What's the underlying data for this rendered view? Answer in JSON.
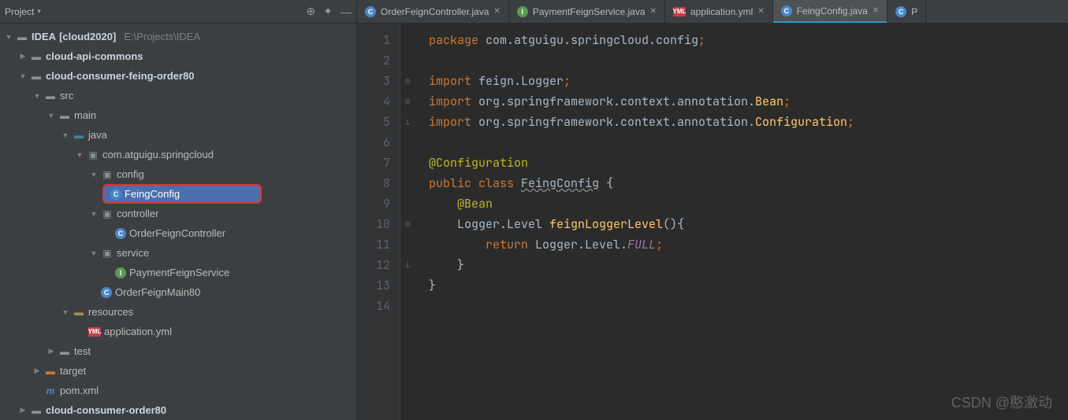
{
  "sidebar": {
    "title": "Project",
    "root": {
      "name": "IDEA",
      "project": "[cloud2020]",
      "path": "E:\\Projects\\IDEA"
    },
    "modules": {
      "api_commons": "cloud-api-commons",
      "feign_order": "cloud-consumer-feing-order80",
      "test": "test",
      "target": "target",
      "pom": "pom.xml",
      "last": "cloud-consumer-order80"
    },
    "src": {
      "label": "src",
      "main": "main",
      "java": "java",
      "pkg": "com.atguigu.springcloud",
      "config": "config",
      "feing": "FeingConfig",
      "controller": "controller",
      "orderctrl": "OrderFeignController",
      "service": "service",
      "paysvc": "PaymentFeignService",
      "mainclass": "OrderFeignMain80",
      "resources": "resources",
      "appyml": "application.yml"
    }
  },
  "tabs": [
    {
      "label": "OrderFeignController.java",
      "type": "java"
    },
    {
      "label": "PaymentFeignService.java",
      "type": "interface"
    },
    {
      "label": "application.yml",
      "type": "yml"
    },
    {
      "label": "FeingConfig.java",
      "type": "java",
      "active": true
    },
    {
      "label": "P",
      "type": "java",
      "partial": true
    }
  ],
  "code": {
    "lines": [
      1,
      2,
      3,
      4,
      5,
      6,
      7,
      8,
      9,
      10,
      11,
      12,
      13,
      14
    ],
    "l1_kw": "package",
    "l1_pkg": " com.atguigu.springcloud.config",
    "semi": ";",
    "l3_kw": "import",
    "l3_pkg": " feign.Logger",
    "l4_kw": "import",
    "l4_pkg": " org.springframework.context.annotation.",
    "l4_cls": "Bean",
    "l5_kw": "import",
    "l5_pkg": " org.springframework.context.annotation.",
    "l5_cls": "Configuration",
    "l7_ann": "@Configuration",
    "l8_pub": "public class ",
    "l8_name": "FeingConfig",
    "l8_brace": " {",
    "l9_ann": "@Bean",
    "l10_type": "Logger.Level ",
    "l10_fn": "feignLoggerLevel",
    "l10_tail": "(){",
    "l11_ret": "return",
    "l11_val": " Logger.Level.",
    "l11_full": "FULL",
    "l12": "}",
    "l13": "}"
  },
  "watermark": "CSDN @憨激动"
}
